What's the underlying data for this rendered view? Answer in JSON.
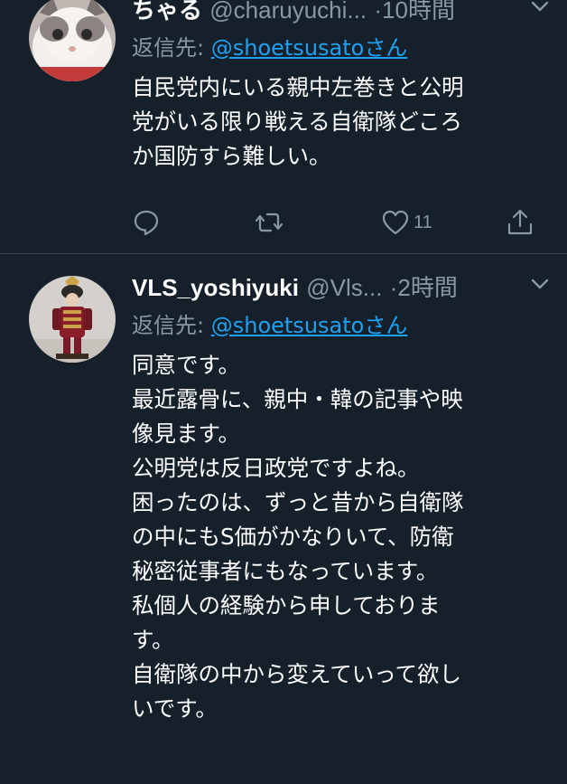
{
  "tweets": [
    {
      "name": "ちゃる",
      "handle": "@charuyuchi...",
      "time": "10時間",
      "reply_prefix": "返信先:",
      "reply_to": "@shoetsusatoさん",
      "lines": [
        "自民党内にいる親中左巻きと公明",
        "党がいる限り戦える自衛隊どころ",
        "か国防すら難しい。"
      ],
      "like_count": "11"
    },
    {
      "name": "VLS_yoshiyuki",
      "handle": "@Vls...",
      "time": "2時間",
      "reply_prefix": "返信先:",
      "reply_to": "@shoetsusatoさん",
      "lines": [
        "同意です。",
        "最近露骨に、親中・韓の記事や映",
        "像見ます。",
        "公明党は反日政党ですよね。",
        "困ったのは、ずっと昔から自衛隊",
        "の中にもS価がかなりいて、防衛",
        "秘密従事者にもなっています。",
        "私個人の経験から申しておりま",
        "す。",
        "自衛隊の中から変えていって欲し",
        "いです。"
      ]
    }
  ],
  "separator": "·",
  "colors": {
    "background": "#15202b",
    "text": "#ffffff",
    "muted": "#8899a6",
    "link": "#1da1f2",
    "divider": "#38444d"
  },
  "icons": {
    "reply": "speech-bubble-icon",
    "retweet": "retweet-icon",
    "like": "heart-icon",
    "share": "share-icon",
    "menu": "chevron-down-icon"
  }
}
